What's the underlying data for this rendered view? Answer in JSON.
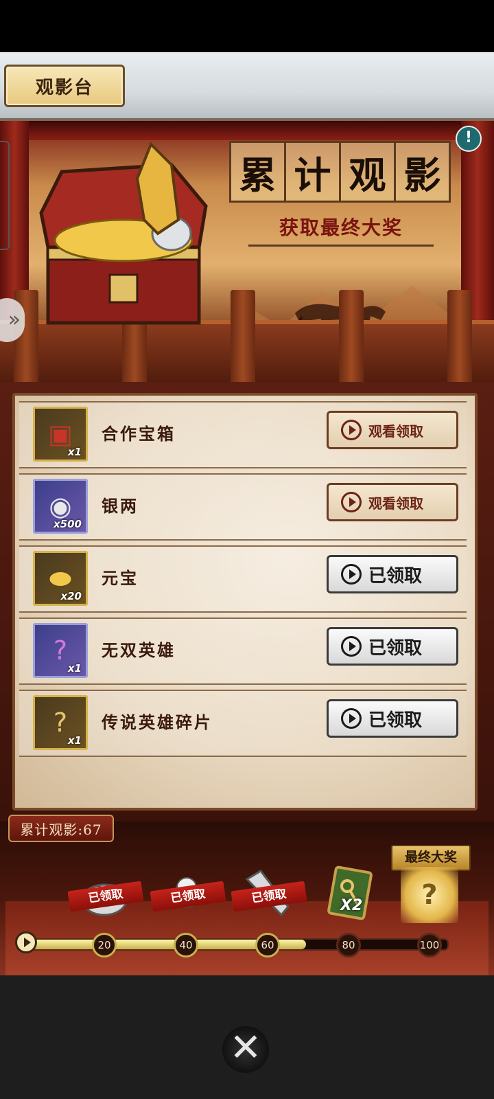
{
  "header": {
    "title": "观影台"
  },
  "banner": {
    "title_chars": [
      "累",
      "计",
      "观",
      "影"
    ],
    "subtitle": "获取最终大奖",
    "info_icon": "exclamation-icon",
    "side_arrow_icon": "double-chevron-right-icon"
  },
  "rewards": [
    {
      "name": "合作宝箱",
      "count": "x1",
      "icon": "treasure-chest-icon",
      "action": "观看领取",
      "state": "available"
    },
    {
      "name": "银两",
      "count": "x500",
      "icon": "silver-coin-icon",
      "action": "观看领取",
      "state": "available"
    },
    {
      "name": "元宝",
      "count": "x20",
      "icon": "gold-ingot-icon",
      "action": "已领取",
      "state": "claimed"
    },
    {
      "name": "无双英雄",
      "count": "x1",
      "icon": "mystery-hero-icon",
      "action": "已领取",
      "state": "claimed"
    },
    {
      "name": "传说英雄碎片",
      "count": "x1",
      "icon": "hero-fragment-icon",
      "action": "已领取",
      "state": "claimed"
    }
  ],
  "progress": {
    "label": "累计观影:67",
    "value": 67,
    "max": 100,
    "milestones": [
      "20",
      "40",
      "60",
      "80",
      "100"
    ],
    "claimed_label": "已领取",
    "final_label": "最终大奖",
    "x2_label": "X2",
    "milestone_rewards": [
      "silver-pile-icon",
      "silver-bowl-icon",
      "silver-horn-icon",
      "golden-key-card-icon",
      "mystery-hero-icon"
    ]
  },
  "colors": {
    "gold_accent": "#c7b24e",
    "claimed_red": "#c6231a",
    "panel_bg": "#efe2cf"
  },
  "close_icon": "close-x-icon"
}
